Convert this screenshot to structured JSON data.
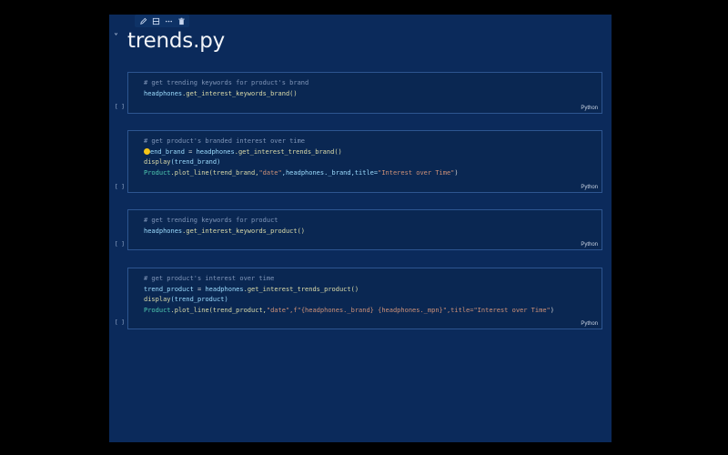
{
  "notebook": {
    "title": "trends.py",
    "collapse_icon": "chevron-down-icon",
    "toolbar_icons": [
      "pencil-icon",
      "split-cell-icon",
      "more-icon",
      "trash-icon"
    ]
  },
  "cells": [
    {
      "bracket": "[ ]",
      "language": "Python",
      "comment": "# get trending keywords for product's brand",
      "line2_obj": "headphones",
      "line2_call": ".get_interest_keywords_brand()"
    },
    {
      "bracket": "[ ]",
      "language": "Python",
      "comment": "# get product's branded interest over time",
      "line2_var": "end_brand",
      "line2_assign": " = ",
      "line2_obj": "headphones",
      "line2_call": ".get_interest_trends_brand()",
      "line3_fn": "display",
      "line3_args": "(trend_brand)",
      "line4_obj": "Product",
      "line4_call": ".plot_line(trend_brand,",
      "line4_str1": "\"date\"",
      "line4_mid": ",headphones._brand,title=",
      "line4_str2": "\"Interest over Time\"",
      "line4_end": ")"
    },
    {
      "bracket": "[ ]",
      "language": "Python",
      "comment": "# get trending keywords for product",
      "line2_obj": "headphones",
      "line2_call": ".get_interest_keywords_product()"
    },
    {
      "bracket": "[ ]",
      "language": "Python",
      "comment": "# get product's interest over time",
      "line2_var": "trend_product",
      "line2_assign": " = ",
      "line2_obj": "headphones",
      "line2_call": ".get_interest_trends_product()",
      "line3_fn": "display",
      "line3_args": "(trend_product)",
      "line4_obj": "Product",
      "line4_call": ".plot_line(trend_product,",
      "line4_str1": "\"date\"",
      "line4_mid": ",f\"{headphones._brand} {headphones._mpn}\",title=",
      "line4_str2": "\"Interest over Time\"",
      "line4_end": ")"
    }
  ]
}
